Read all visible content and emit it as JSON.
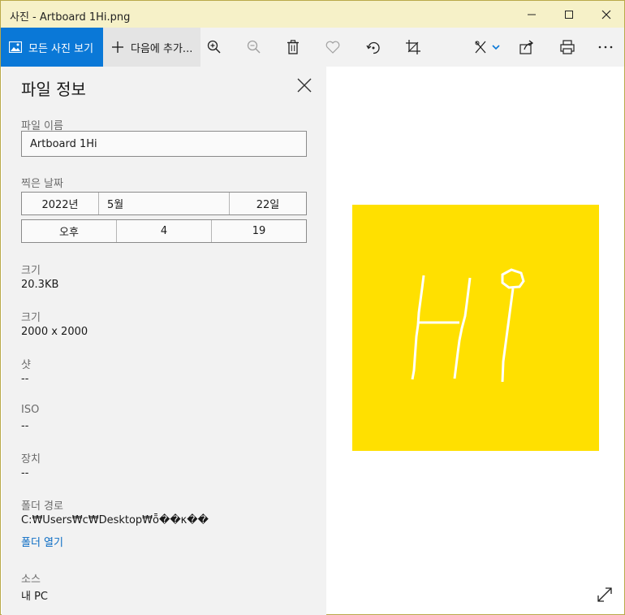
{
  "window": {
    "title": "사진 - Artboard 1Hi.png",
    "controls": {
      "minimize": "minimize-icon",
      "maximize": "maximize-icon",
      "close": "close-icon"
    }
  },
  "toolbar": {
    "all_photos_label": "모든 사진 보기",
    "add_to_label": "다음에 추가...",
    "icons": [
      "zoom-in-icon",
      "zoom-out-icon",
      "delete-icon",
      "favorite-icon",
      "rotate-icon",
      "crop-icon",
      "edit-icon",
      "share-icon",
      "print-icon",
      "more-icon"
    ]
  },
  "panel": {
    "title": "파일 정보",
    "file_name_label": "파일 이름",
    "file_name_value": "Artboard 1Hi",
    "date_taken_label": "찍은 날짜",
    "date": {
      "year": "2022년",
      "month": "5월",
      "day": "22일"
    },
    "time": {
      "ampm": "오후",
      "hour": "4",
      "minute": "19"
    },
    "size_label": "크기",
    "size_value": "20.3KB",
    "dimensions_label": "크기",
    "dimensions_value": "2000 x 2000",
    "shot_label": "샷",
    "shot_value": "--",
    "iso_label": "ISO",
    "iso_value": "--",
    "device_label": "장치",
    "device_value": "--",
    "folder_path_label": "폴더 경로",
    "folder_path_value": "C:₩Users₩c₩Desktop₩ȭ��κ��",
    "open_folder_link": "폴더 열기",
    "source_label": "소스",
    "source_value": "내 PC"
  },
  "image": {
    "background_color": "#ffe000",
    "drawing_text": "Hi"
  },
  "colors": {
    "accent": "#0a78d7",
    "titlebar": "#f6f1c8",
    "panel": "#f2f2f2",
    "link": "#0a6cc4"
  }
}
